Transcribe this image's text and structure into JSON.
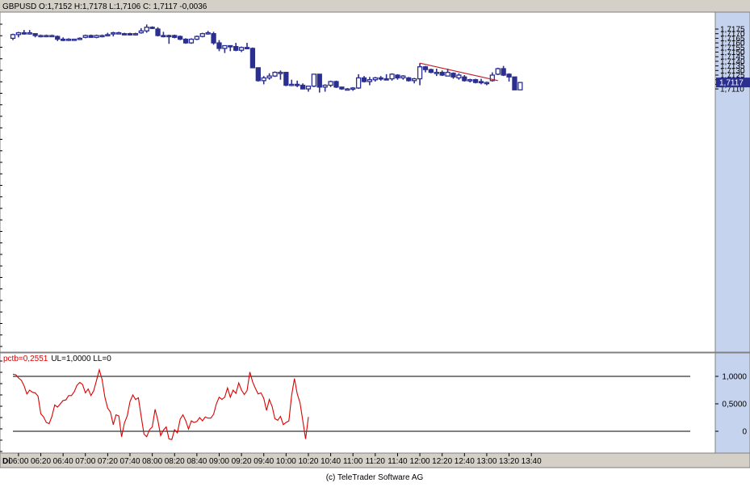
{
  "header": {
    "symbol": "GBPUSD",
    "ohlc": "O:1,7152 H:1,7178 L:1,7106 C: 1,7117 -0,0036"
  },
  "indicator": {
    "label_name": "pctb=0,2551",
    "label_rest": "UL=1,0000 LL=0",
    "axis_labels": [
      "1,0000",
      "0,5000",
      "0"
    ]
  },
  "footer": {
    "day_label": "Di",
    "copyright": "(c) TeleTrader Software AG"
  },
  "colors": {
    "background": "#ffffff",
    "panel_gray": "#d4d0c8",
    "axis_panel": "#c6d3ef",
    "candle": "#2b2f8f",
    "indicator_line": "#dd0000",
    "trendline": "#c0202a",
    "last_price_box": "#2b2f8f"
  },
  "chart_data": [
    {
      "type": "candlestick",
      "title": "GBPUSD O:1,7152 H:1,7178 L:1,7106 C: 1,7117 -0,0036",
      "x_ticks": [
        "06:00",
        "06:20",
        "06:40",
        "07:00",
        "07:20",
        "07:40",
        "08:00",
        "08:20",
        "08:40",
        "09:00",
        "09:20",
        "09:40",
        "10:00",
        "10:20",
        "10:40",
        "11:00",
        "11:20",
        "11:40",
        "12:00",
        "12:20",
        "12:40",
        "13:00",
        "13:20",
        "13:40"
      ],
      "y_ticks": [
        "1,7175",
        "1,7170",
        "1,7165",
        "1,7160",
        "1,7155",
        "1,7150",
        "1,7145",
        "1,7140",
        "1,7135",
        "1,7130",
        "1,7125",
        "1,7120",
        "1,7115",
        "1,7110"
      ],
      "ylim": [
        1.7104,
        1.7184
      ],
      "last_price": "1,7117",
      "interval_minutes": 5,
      "candles": [
        [
          "05:55",
          1.7165,
          1.717,
          1.7163,
          1.7169
        ],
        [
          "06:00",
          1.7169,
          1.7172,
          1.7166,
          1.7171
        ],
        [
          "06:05",
          1.7171,
          1.7174,
          1.7169,
          1.717
        ],
        [
          "06:10",
          1.717,
          1.7174,
          1.7169,
          1.7171
        ],
        [
          "06:15",
          1.717,
          1.717,
          1.7166,
          1.7168
        ],
        [
          "06:20",
          1.7167,
          1.7169,
          1.7166,
          1.7168
        ],
        [
          "06:25",
          1.7168,
          1.7169,
          1.7167,
          1.7168
        ],
        [
          "06:30",
          1.7168,
          1.7169,
          1.7167,
          1.7168
        ],
        [
          "06:35",
          1.7167,
          1.7168,
          1.7162,
          1.7164
        ],
        [
          "06:40",
          1.7164,
          1.7166,
          1.7162,
          1.7163
        ],
        [
          "06:45",
          1.7163,
          1.7165,
          1.7162,
          1.7164
        ],
        [
          "06:50",
          1.7164,
          1.7164,
          1.7163,
          1.7164
        ],
        [
          "06:55",
          1.7164,
          1.7166,
          1.7163,
          1.7165
        ],
        [
          "07:00",
          1.7166,
          1.7169,
          1.7165,
          1.7168
        ],
        [
          "07:05",
          1.7168,
          1.7169,
          1.7166,
          1.7166
        ],
        [
          "07:10",
          1.7166,
          1.7169,
          1.7165,
          1.7168
        ],
        [
          "07:15",
          1.7167,
          1.7169,
          1.7166,
          1.7168
        ],
        [
          "07:20",
          1.7168,
          1.7171,
          1.7167,
          1.7169
        ],
        [
          "07:25",
          1.717,
          1.7172,
          1.7167,
          1.7171
        ],
        [
          "07:30",
          1.7171,
          1.7172,
          1.717,
          1.7171
        ],
        [
          "07:35",
          1.717,
          1.7171,
          1.7169,
          1.7169
        ],
        [
          "07:40",
          1.717,
          1.7171,
          1.7168,
          1.7169
        ],
        [
          "07:45",
          1.7169,
          1.7171,
          1.7168,
          1.717
        ],
        [
          "07:50",
          1.7171,
          1.7176,
          1.717,
          1.7173
        ],
        [
          "07:55",
          1.7173,
          1.718,
          1.7171,
          1.7177
        ],
        [
          "08:00",
          1.7177,
          1.7178,
          1.7175,
          1.7176
        ],
        [
          "08:05",
          1.7175,
          1.7177,
          1.7167,
          1.7168
        ],
        [
          "08:10",
          1.7168,
          1.7172,
          1.7166,
          1.7167
        ],
        [
          "08:15",
          1.7168,
          1.7169,
          1.7159,
          1.7167
        ],
        [
          "08:20",
          1.7168,
          1.7169,
          1.7165,
          1.7166
        ],
        [
          "08:25",
          1.7167,
          1.7168,
          1.7163,
          1.7164
        ],
        [
          "08:30",
          1.7164,
          1.7165,
          1.7159,
          1.716
        ],
        [
          "08:35",
          1.716,
          1.7165,
          1.7159,
          1.7164
        ],
        [
          "08:40",
          1.7164,
          1.7168,
          1.7163,
          1.7167
        ],
        [
          "08:45",
          1.7167,
          1.7171,
          1.7166,
          1.717
        ],
        [
          "08:50",
          1.717,
          1.7173,
          1.7169,
          1.7171
        ],
        [
          "08:55",
          1.717,
          1.7172,
          1.7158,
          1.716
        ],
        [
          "09:00",
          1.716,
          1.7163,
          1.7151,
          1.7154
        ],
        [
          "09:05",
          1.7154,
          1.7157,
          1.7149,
          1.7157
        ],
        [
          "09:10",
          1.7157,
          1.7157,
          1.7151,
          1.7156
        ],
        [
          "09:15",
          1.7156,
          1.716,
          1.7151,
          1.7152
        ],
        [
          "09:20",
          1.7152,
          1.7156,
          1.715,
          1.7155
        ],
        [
          "09:25",
          1.7155,
          1.716,
          1.7153,
          1.7154
        ],
        [
          "09:30",
          1.7154,
          1.7155,
          1.7133,
          1.7133
        ],
        [
          "09:35",
          1.7133,
          1.7133,
          1.7118,
          1.7119
        ],
        [
          "09:40",
          1.7119,
          1.7124,
          1.7115,
          1.7122
        ],
        [
          "09:45",
          1.7122,
          1.7127,
          1.712,
          1.7124
        ],
        [
          "09:50",
          1.7124,
          1.7129,
          1.7123,
          1.7128
        ],
        [
          "09:55",
          1.7128,
          1.713,
          1.712,
          1.7128
        ],
        [
          "10:00",
          1.7128,
          1.7128,
          1.7113,
          1.7114
        ],
        [
          "10:05",
          1.7114,
          1.712,
          1.7113,
          1.7115
        ],
        [
          "10:10",
          1.7115,
          1.7119,
          1.7112,
          1.7114
        ],
        [
          "10:15",
          1.7114,
          1.7116,
          1.711,
          1.711
        ],
        [
          "10:20",
          1.711,
          1.7113,
          1.7107,
          1.7113
        ],
        [
          "10:25",
          1.7113,
          1.7126,
          1.7112,
          1.7126
        ],
        [
          "10:30",
          1.7126,
          1.7126,
          1.7106,
          1.7112
        ],
        [
          "10:35",
          1.7112,
          1.7115,
          1.7107,
          1.7114
        ],
        [
          "10:40",
          1.7114,
          1.7119,
          1.7112,
          1.7118
        ],
        [
          "10:45",
          1.7118,
          1.7119,
          1.7111,
          1.7112
        ],
        [
          "10:50",
          1.7112,
          1.7111,
          1.7109,
          1.711
        ],
        [
          "10:55",
          1.711,
          1.7111,
          1.7109,
          1.711
        ],
        [
          "11:00",
          1.711,
          1.7112,
          1.7108,
          1.7111
        ],
        [
          "11:05",
          1.7111,
          1.7126,
          1.711,
          1.7122
        ],
        [
          "11:10",
          1.7122,
          1.7124,
          1.7117,
          1.7118
        ],
        [
          "11:15",
          1.7118,
          1.7123,
          1.7114,
          1.712
        ],
        [
          "11:20",
          1.712,
          1.7123,
          1.7118,
          1.7122
        ],
        [
          "11:25",
          1.7122,
          1.7124,
          1.7119,
          1.7121
        ],
        [
          "11:30",
          1.7121,
          1.7126,
          1.712,
          1.712
        ],
        [
          "11:35",
          1.7121,
          1.7127,
          1.7119,
          1.7126
        ],
        [
          "11:40",
          1.7125,
          1.7126,
          1.712,
          1.7122
        ],
        [
          "11:45",
          1.7122,
          1.7125,
          1.712,
          1.7124
        ],
        [
          "11:50",
          1.7122,
          1.7123,
          1.7118,
          1.7119
        ],
        [
          "11:55",
          1.7119,
          1.7122,
          1.7116,
          1.7121
        ],
        [
          "12:00",
          1.7121,
          1.7138,
          1.7114,
          1.7134
        ],
        [
          "12:05",
          1.7134,
          1.7135,
          1.7128,
          1.7131
        ],
        [
          "12:10",
          1.7131,
          1.7132,
          1.7127,
          1.7128
        ],
        [
          "12:15",
          1.7128,
          1.7132,
          1.7124,
          1.7128
        ],
        [
          "12:20",
          1.7128,
          1.713,
          1.7124,
          1.7125
        ],
        [
          "12:25",
          1.7124,
          1.7132,
          1.7124,
          1.7128
        ],
        [
          "12:30",
          1.7127,
          1.7128,
          1.7121,
          1.7123
        ],
        [
          "12:35",
          1.7122,
          1.7127,
          1.712,
          1.7125
        ],
        [
          "12:40",
          1.7123,
          1.7125,
          1.7118,
          1.7119
        ],
        [
          "12:45",
          1.7119,
          1.7121,
          1.7117,
          1.712
        ],
        [
          "12:50",
          1.712,
          1.7121,
          1.7116,
          1.7117
        ],
        [
          "12:55",
          1.7118,
          1.7121,
          1.7115,
          1.7117
        ],
        [
          "13:00",
          1.7117,
          1.7118,
          1.7114,
          1.7117
        ],
        [
          "13:05",
          1.7119,
          1.7128,
          1.7118,
          1.7125
        ],
        [
          "13:10",
          1.7126,
          1.7133,
          1.7125,
          1.7132
        ],
        [
          "13:15",
          1.7132,
          1.7135,
          1.7124,
          1.7125
        ],
        [
          "13:20",
          1.7126,
          1.7127,
          1.7118,
          1.7123
        ],
        [
          "13:25",
          1.7123,
          1.7123,
          1.7109,
          1.7109
        ],
        [
          "13:30",
          1.7109,
          1.7117,
          1.7109,
          1.7117
        ]
      ]
    },
    {
      "type": "line",
      "title": "pctb=0,2551 UL=1,0000 LL=0",
      "y_ticks": [
        "1,0000",
        "0,5000",
        "0"
      ],
      "ylim": [
        -0.25,
        1.1
      ],
      "reference_lines": [
        1.0,
        0.0
      ],
      "x_start": "05:55",
      "interval_minutes": 2.5,
      "values": [
        1.04,
        1.03,
        0.97,
        0.93,
        0.83,
        0.68,
        0.75,
        0.71,
        0.7,
        0.64,
        0.32,
        0.26,
        0.16,
        0.14,
        0.27,
        0.48,
        0.44,
        0.5,
        0.56,
        0.57,
        0.65,
        0.65,
        0.72,
        0.84,
        0.89,
        0.85,
        0.7,
        0.77,
        0.65,
        0.74,
        0.93,
        1.12,
        0.94,
        0.62,
        0.42,
        0.35,
        0.12,
        0.3,
        0.28,
        -0.1,
        0.15,
        0.28,
        0.54,
        0.66,
        0.58,
        0.61,
        0.28,
        -0.05,
        -0.1,
        0.03,
        0.08,
        0.4,
        0.2,
        -0.08,
        0.02,
        0.08,
        -0.14,
        -0.15,
        0.03,
        -0.03,
        0.22,
        0.3,
        0.19,
        0.04,
        0.19,
        0.16,
        0.18,
        0.25,
        0.19,
        0.26,
        0.24,
        0.24,
        0.31,
        0.5,
        0.62,
        0.58,
        0.62,
        0.79,
        0.62,
        0.75,
        0.69,
        0.88,
        0.75,
        0.67,
        0.74,
        1.08,
        0.9,
        0.78,
        0.68,
        0.7,
        0.6,
        0.38,
        0.58,
        0.45,
        0.23,
        0.2,
        0.27,
        0.12,
        0.16,
        0.19,
        0.66,
        0.96,
        0.68,
        0.52,
        0.19,
        -0.14,
        0.26
      ]
    }
  ]
}
